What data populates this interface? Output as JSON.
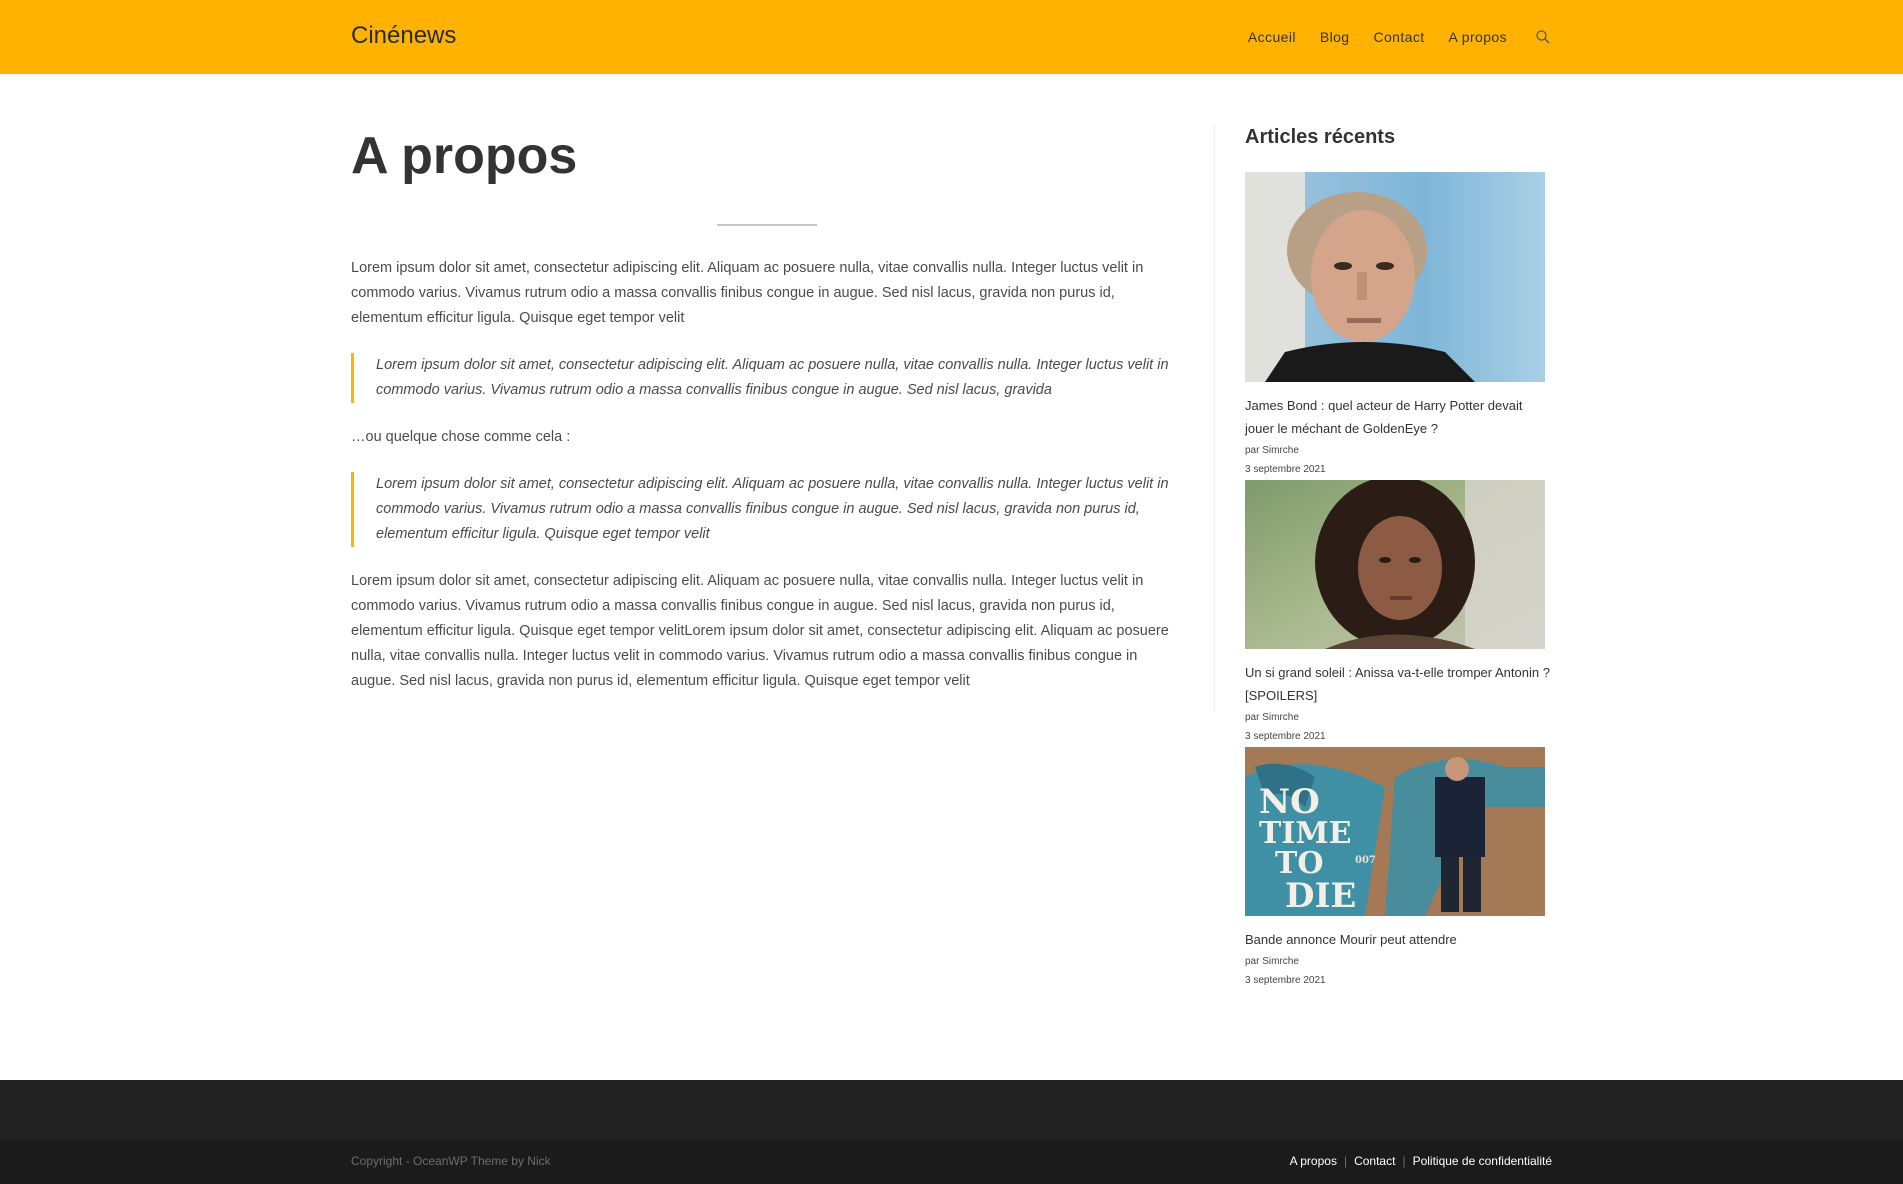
{
  "header": {
    "logo": "Cinénews",
    "nav": [
      {
        "label": "Accueil"
      },
      {
        "label": "Blog"
      },
      {
        "label": "Contact"
      },
      {
        "label": "A propos"
      }
    ],
    "search_icon": "search-icon",
    "background_color": "#FFB300"
  },
  "main": {
    "title": "A propos",
    "paragraphs": [
      "Lorem ipsum dolor sit amet, consectetur adipiscing elit. Aliquam ac posuere nulla, vitae convallis nulla. Integer luctus velit in commodo varius. Vivamus rutrum odio a massa convallis finibus congue in augue. Sed nisl lacus, gravida non purus id, elementum efficitur ligula. Quisque eget tempor velit",
      "Lorem ipsum dolor sit amet, consectetur adipiscing elit. Aliquam ac posuere nulla, vitae convallis nulla. Integer luctus velit in commodo varius. Vivamus rutrum odio a massa convallis finibus congue in augue. Sed nisl lacus, gravida",
      "…ou quelque chose comme cela :",
      "Lorem ipsum dolor sit amet, consectetur adipiscing elit. Aliquam ac posuere nulla, vitae convallis nulla. Integer luctus velit in commodo varius. Vivamus rutrum odio a massa convallis finibus congue in augue. Sed nisl lacus, gravida non purus id, elementum efficitur ligula. Quisque eget tempor velit",
      "Lorem ipsum dolor sit amet, consectetur adipiscing elit. Aliquam ac posuere nulla, vitae convallis nulla. Integer luctus velit in commodo varius. Vivamus rutrum odio a massa convallis finibus congue in augue. Sed nisl lacus, gravida non purus id, elementum efficitur ligula. Quisque eget tempor velitLorem ipsum dolor sit amet, consectetur adipiscing elit. Aliquam ac posuere nulla, vitae convallis nulla. Integer luctus velit in commodo varius. Vivamus rutrum odio a massa convallis finibus congue in augue. Sed nisl lacus, gravida non purus id, elementum efficitur ligula. Quisque eget tempor velit"
    ],
    "accent_color": "#FFB300"
  },
  "sidebar": {
    "title": "Articles récents",
    "posts": [
      {
        "title": "James Bond : quel acteur de Harry Potter devait jouer le méchant de GoldenEye ?",
        "author": "par Simrche",
        "date": "3 septembre 2021"
      },
      {
        "title": "Un si grand soleil : Anissa va-t-elle tromper Antonin ? [SPOILERS]",
        "author": "par Simrche",
        "date": "3 septembre 2021"
      },
      {
        "title": "Bande annonce Mourir peut attendre",
        "author": "par Simrche",
        "date": "3 septembre 2021",
        "poster_text": [
          "NO",
          "TIME",
          "TO",
          "DIE"
        ],
        "poster_badge": "007"
      }
    ]
  },
  "footer": {
    "copyright": "Copyright - OceanWP Theme by Nick",
    "links": [
      {
        "label": "A propos"
      },
      {
        "label": "Contact"
      },
      {
        "label": "Politique de confidentialité"
      }
    ],
    "separator": "|"
  }
}
